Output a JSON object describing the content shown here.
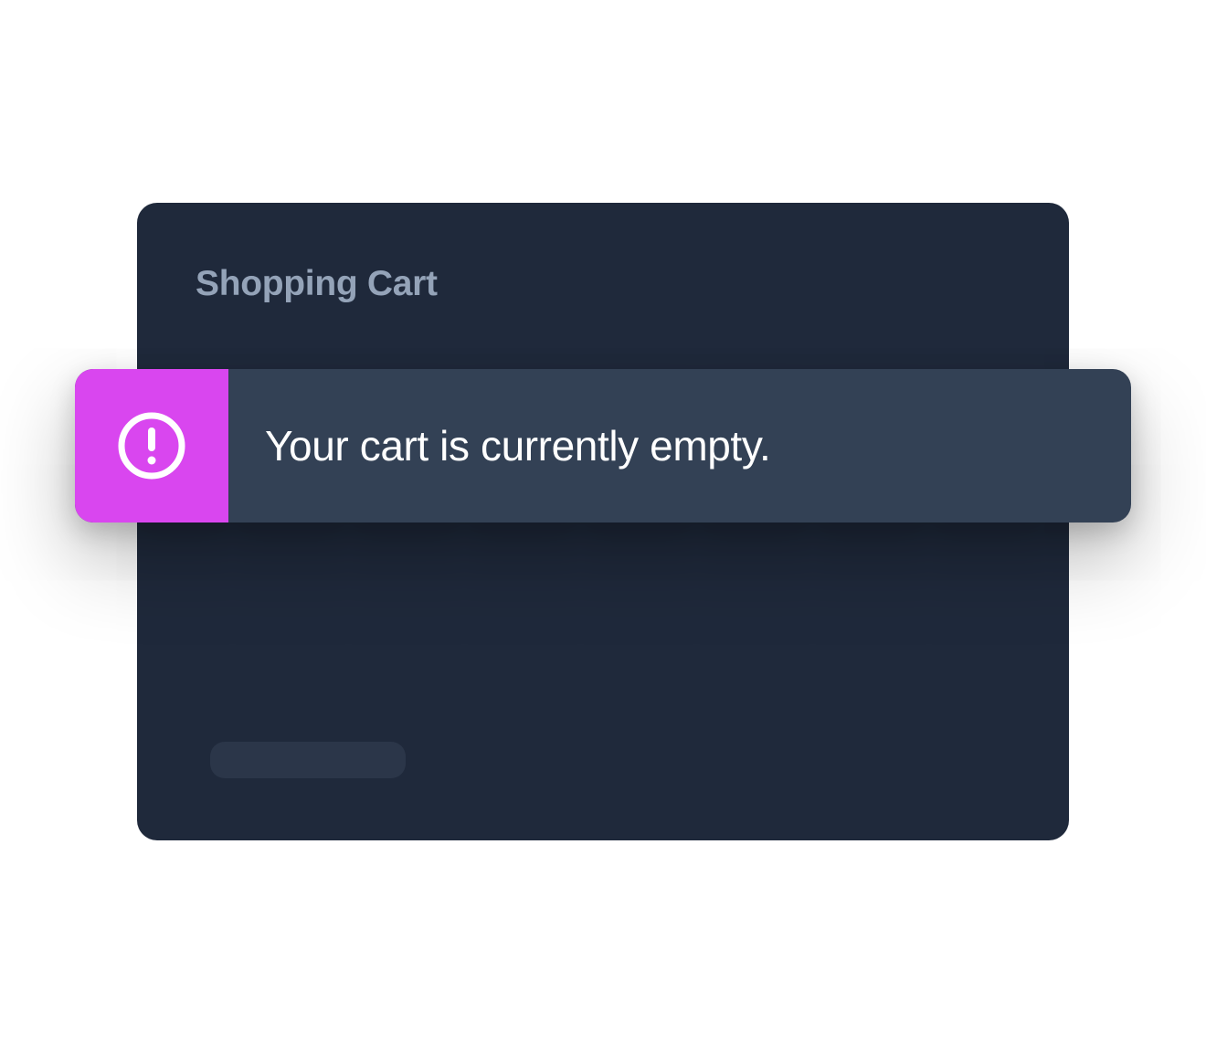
{
  "cart": {
    "title": "Shopping Cart"
  },
  "alert": {
    "icon": "exclamation-circle-icon",
    "message": "Your cart is currently empty."
  },
  "colors": {
    "page_background": "#ffffff",
    "card_background": "#1f293b",
    "title_text": "#94a3b8",
    "alert_background": "#334155",
    "alert_accent": "#d946ef",
    "alert_text": "#ffffff",
    "placeholder_bar": "#2b3649"
  }
}
